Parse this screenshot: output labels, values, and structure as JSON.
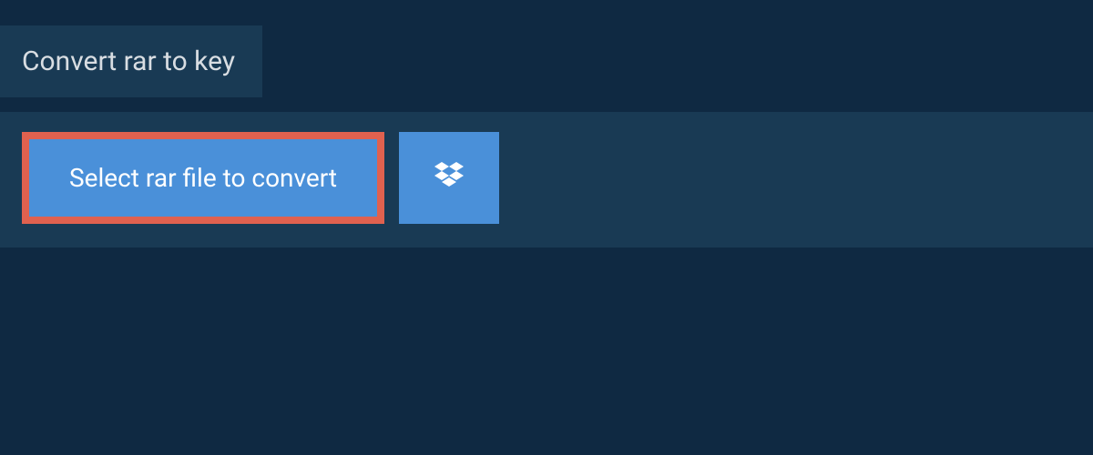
{
  "header": {
    "title": "Convert rar to key"
  },
  "upload": {
    "select_label": "Select rar file to convert"
  }
}
